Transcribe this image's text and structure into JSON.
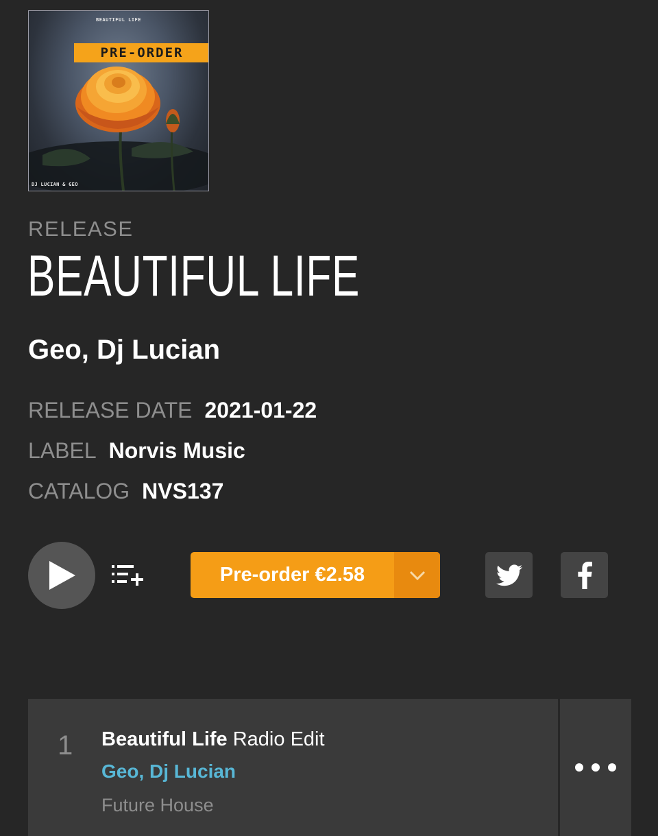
{
  "cover": {
    "top_text": "BEAUTIFUL LIFE",
    "badge": "PRE-ORDER",
    "bottom_text": "DJ LUCIAN & GEO"
  },
  "release": {
    "kind_label": "RELEASE",
    "title": "BEAUTIFUL LIFE",
    "artists": "Geo, Dj Lucian",
    "meta": [
      {
        "key": "RELEASE DATE",
        "value": "2021-01-22"
      },
      {
        "key": "LABEL",
        "value": "Norvis Music"
      },
      {
        "key": "CATALOG",
        "value": "NVS137"
      }
    ]
  },
  "actions": {
    "buy_label": "Pre-order €2.58",
    "icons": [
      "play-icon",
      "add-to-queue-icon",
      "chevron-down-icon",
      "twitter-icon",
      "facebook-icon",
      "more-icon"
    ]
  },
  "colors": {
    "background": "#262626",
    "accent": "#f59d16",
    "link": "#58b7d6",
    "muted": "#8e8e8e"
  },
  "tracks": [
    {
      "number": "1",
      "name": "Beautiful Life",
      "mix": "Radio Edit",
      "artists": "Geo, Dj Lucian",
      "genre": "Future House"
    }
  ]
}
